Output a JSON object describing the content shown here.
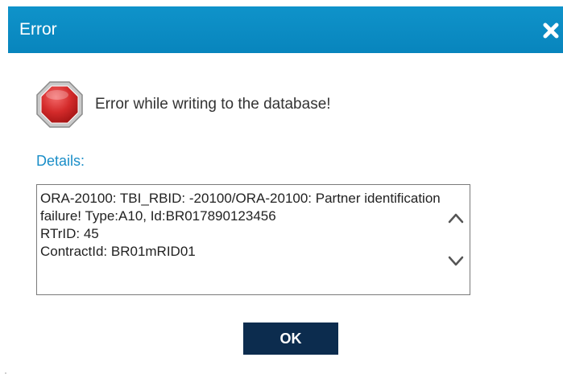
{
  "dialog": {
    "title": "Error",
    "close_icon": "close-icon",
    "status_icon": "stop-sign-icon",
    "message": "Error while writing to the database!",
    "details_label": "Details:",
    "details_text": "ORA-20100: TBI_RBID: -20100/ORA-20100: Partner identification failure! Type:A10, Id:BR017890123456\nRTrID: 45\nContractId: BR01mRID01",
    "scroll_up_icon": "chevron-up-icon",
    "scroll_down_icon": "chevron-down-icon",
    "ok_label": "OK"
  },
  "colors": {
    "titlebar": "#0a8dc4",
    "details_label": "#1a8ec8",
    "ok_button": "#0c2c4e",
    "stop_sign": "#d32a2a"
  }
}
